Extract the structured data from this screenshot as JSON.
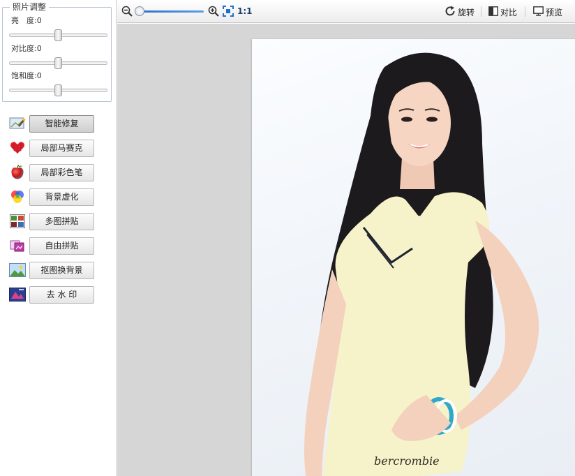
{
  "adjust": {
    "title": "照片调整",
    "brightness": {
      "label": "亮　度:",
      "value": "0",
      "level_fraction": 0.5
    },
    "contrast": {
      "label": "对比度:",
      "value": "0",
      "level_fraction": 0.5
    },
    "saturation": {
      "label": "饱和度:",
      "value": "0",
      "level_fraction": 0.5
    }
  },
  "tools": [
    {
      "label": "智能修复",
      "icon": "magic-wand-icon",
      "active": true
    },
    {
      "label": "局部马赛克",
      "icon": "mosaic-heart-icon",
      "active": false
    },
    {
      "label": "局部彩色笔",
      "icon": "apple-icon",
      "active": false
    },
    {
      "label": "背景虚化",
      "icon": "color-blur-icon",
      "active": false
    },
    {
      "label": "多图拼贴",
      "icon": "collage-icon",
      "active": false
    },
    {
      "label": "自由拼贴",
      "icon": "free-collage-icon",
      "active": false
    },
    {
      "label": "抠图换背景",
      "icon": "landscape-icon",
      "active": false
    },
    {
      "label": "去 水 印",
      "icon": "watermark-icon",
      "active": false
    }
  ],
  "toolbar": {
    "zoom_out_icon": "zoom-out-icon",
    "zoom_in_icon": "zoom-in-icon",
    "fit_icon": "fit-screen-icon",
    "zoom_level_fraction": 0.0,
    "actual_size_label": "1:1",
    "rotate_label": "旋转",
    "compare_label": "对比",
    "preview_label": "预览"
  },
  "photo": {
    "caption_text": "bercrombie"
  },
  "colors": {
    "accent": "#2b6fc7",
    "canvas_bg": "#d6d6d6",
    "panel_border": "#b7c3d0"
  }
}
